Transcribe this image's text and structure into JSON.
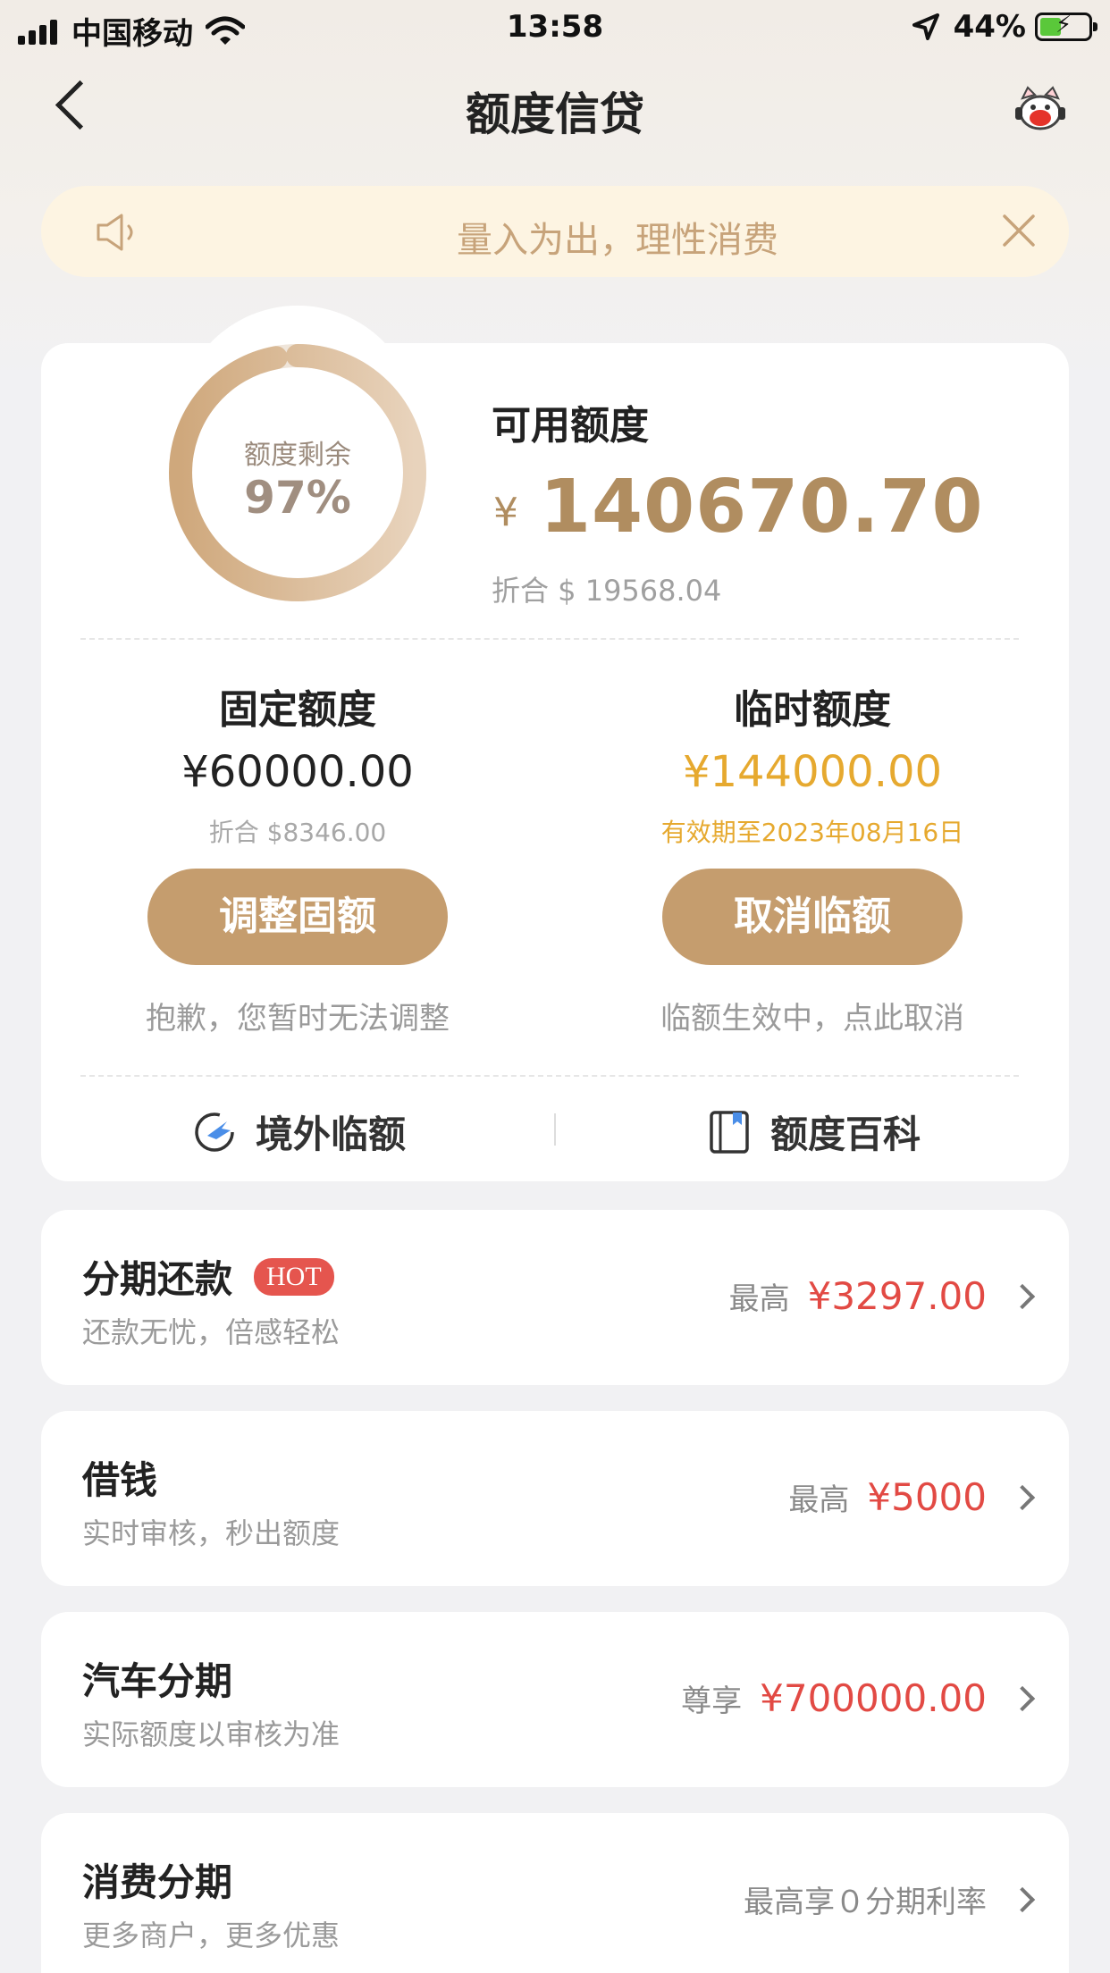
{
  "status_bar": {
    "carrier": "中国移动",
    "time": "13:58",
    "battery": "44%"
  },
  "nav": {
    "title": "额度信贷"
  },
  "notice": {
    "text": "量入为出，理性消费"
  },
  "summary": {
    "ring_label": "额度剩余",
    "ring_percent": "97%",
    "ring_fraction": 0.97,
    "available_title": "可用额度",
    "currency_symbol": "¥",
    "available_amount": "140670.70",
    "available_usd": "折合 $ 19568.04"
  },
  "fixed": {
    "title": "固定额度",
    "amount": "¥60000.00",
    "sub": "折合 $8346.00",
    "button": "调整固额",
    "note": "抱歉，您暂时无法调整"
  },
  "temporary": {
    "title": "临时额度",
    "amount": "¥144000.00",
    "sub": "有效期至2023年08月16日",
    "button": "取消临额",
    "note": "临额生效中，点此取消"
  },
  "links": {
    "overseas": "境外临额",
    "wiki": "额度百科"
  },
  "products": [
    {
      "title": "分期还款",
      "badge": "HOT",
      "sub": "还款无忧，倍感轻松",
      "label": "最高",
      "value": "¥3297.00"
    },
    {
      "title": "借钱",
      "sub": "实时审核，秒出额度",
      "label": "最高",
      "value": "¥5000"
    },
    {
      "title": "汽车分期",
      "sub": "实际额度以审核为准",
      "label": "尊享",
      "value": "¥700000.00"
    },
    {
      "title": "消费分期",
      "sub": "更多商户，更多优惠",
      "label": "最高享０分期利率"
    }
  ],
  "colors": {
    "accent": "#c59d6e",
    "amount": "#b08d60",
    "temp_amount": "#e6a92f",
    "value_red": "#e24a44",
    "notice_bg": "#fdf4e2"
  }
}
